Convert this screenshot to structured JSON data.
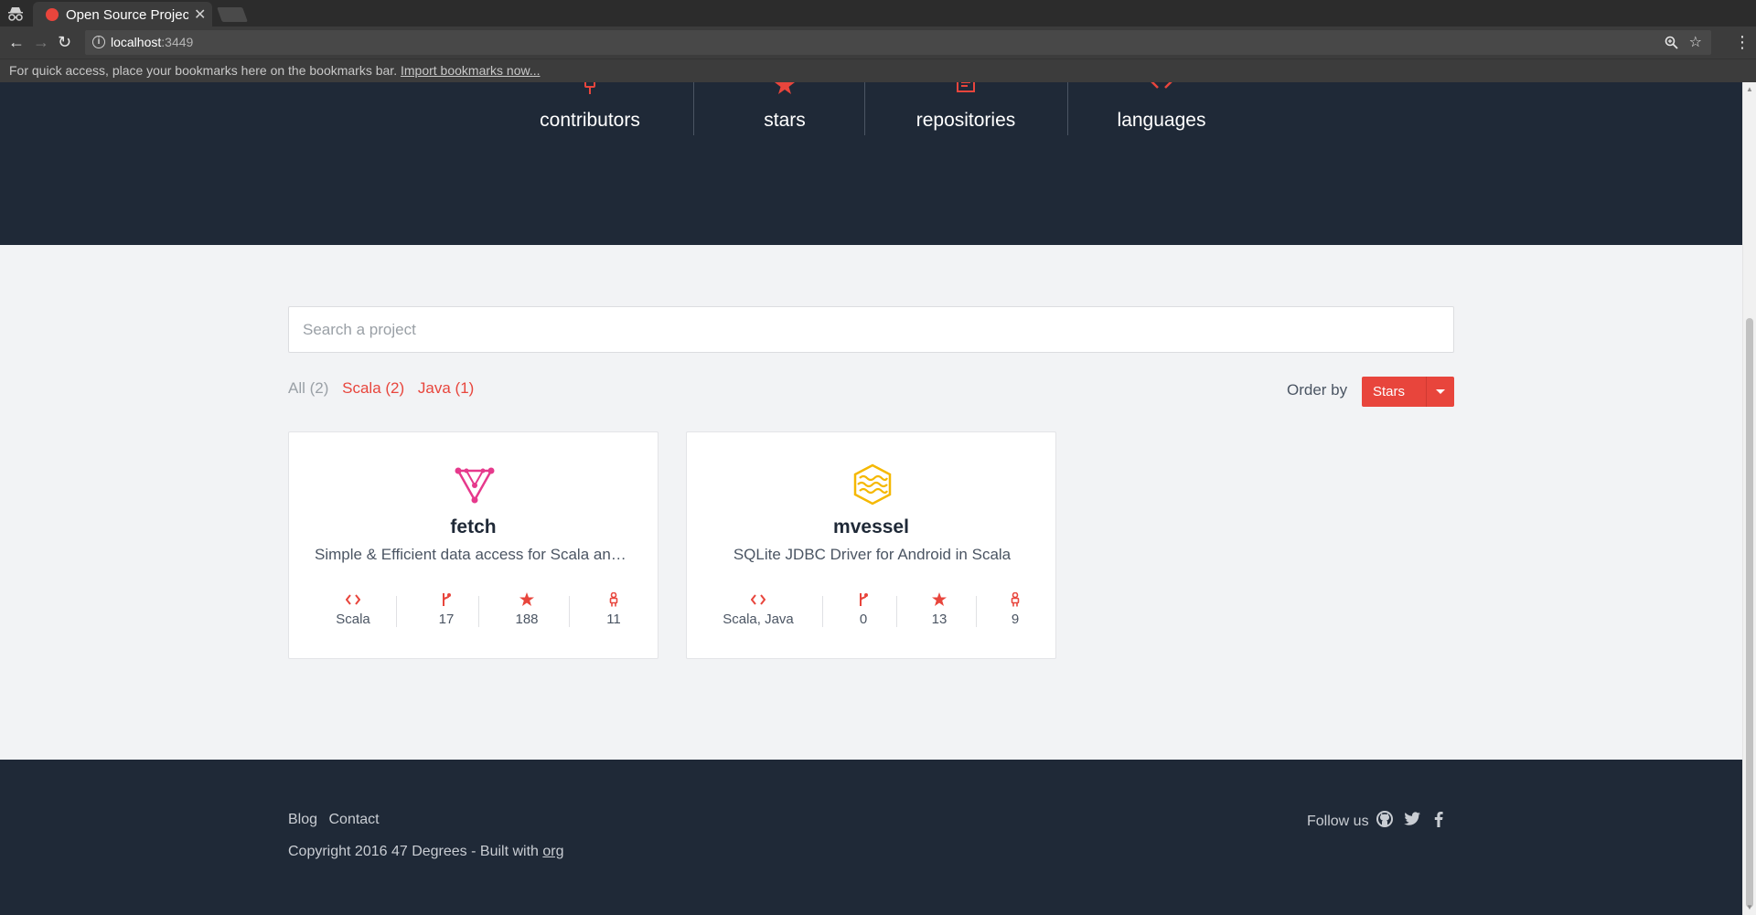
{
  "browser": {
    "tab_title": "Open Source Projects",
    "url_host": "localhost",
    "url_port": ":3449",
    "bookmarks_text": "For quick access, place your bookmarks here on the bookmarks bar.",
    "bookmarks_link": "Import bookmarks now..."
  },
  "hero": {
    "stats": [
      {
        "label": "contributors",
        "icon": "contributor-icon"
      },
      {
        "label": "stars",
        "icon": "star-icon"
      },
      {
        "label": "repositories",
        "icon": "repository-icon"
      },
      {
        "label": "languages",
        "icon": "code-icon"
      }
    ]
  },
  "search": {
    "placeholder": "Search a project"
  },
  "filters": [
    {
      "label": "All (2)",
      "state": "inactive"
    },
    {
      "label": "Scala (2)",
      "state": "active"
    },
    {
      "label": "Java (1)",
      "state": "active"
    }
  ],
  "order": {
    "label": "Order by",
    "value": "Stars"
  },
  "projects": [
    {
      "name": "fetch",
      "description": "Simple & Efficient data access for Scala and Scala.js",
      "language": "Scala",
      "forks": "17",
      "stars": "188",
      "contributors": "11"
    },
    {
      "name": "mvessel",
      "description": "SQLite JDBC Driver for Android in Scala",
      "language": "Scala, Java",
      "forks": "0",
      "stars": "13",
      "contributors": "9"
    }
  ],
  "footer": {
    "links": [
      "Blog",
      "Contact"
    ],
    "copyright": "Copyright 2016 47 Degrees - Built with",
    "org_link": "org",
    "follow": "Follow us"
  },
  "colors": {
    "accent": "#e8453c",
    "dark": "#1f2937",
    "fetch_logo": "#e6398c",
    "mvessel_logo": "#f5b800"
  }
}
